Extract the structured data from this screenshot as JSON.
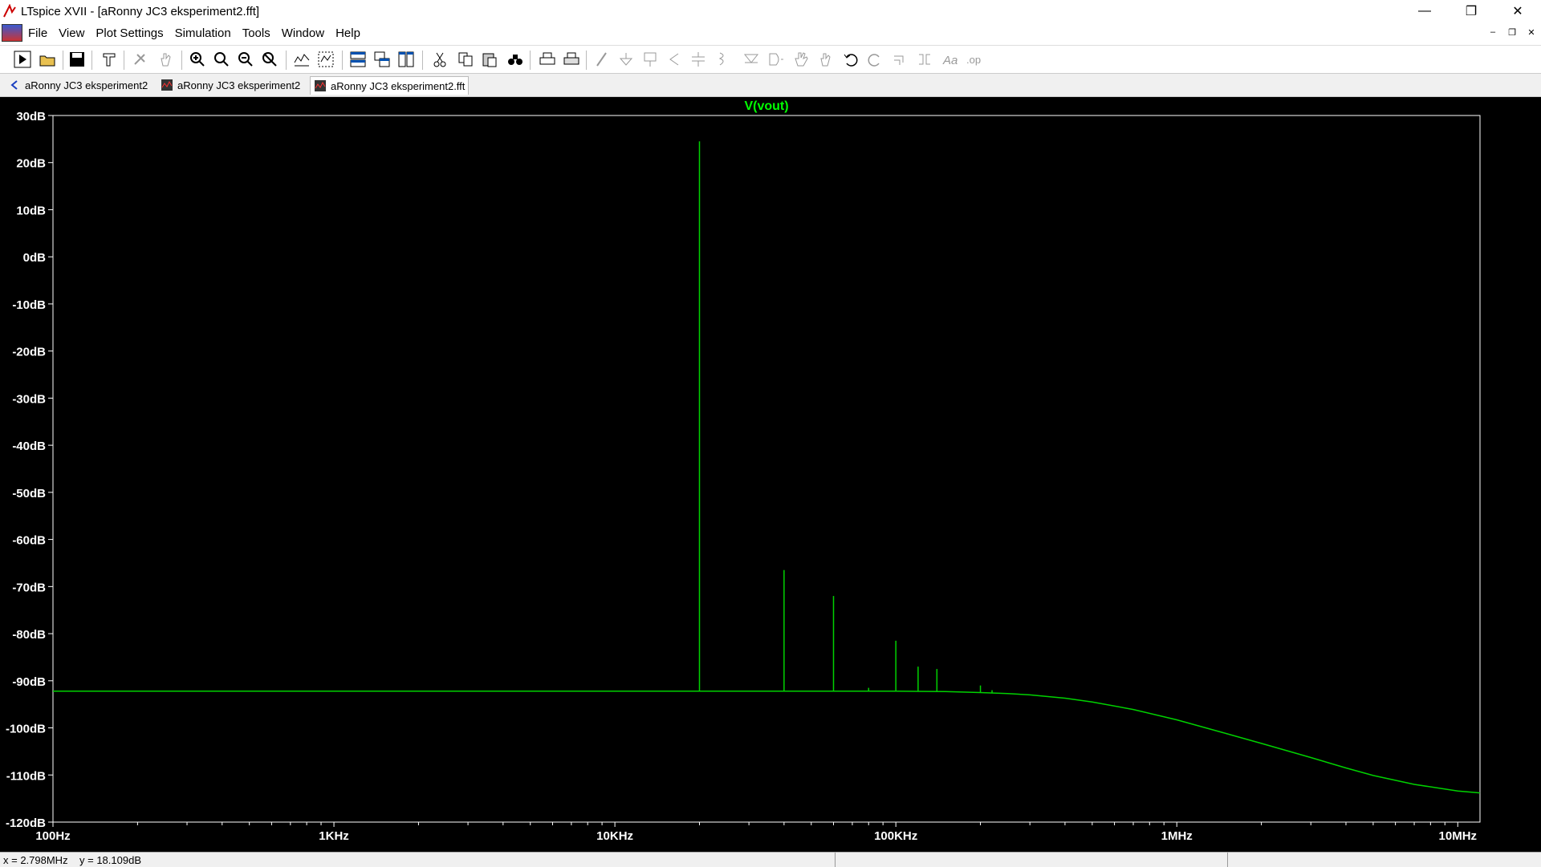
{
  "window": {
    "title": "LTspice XVII - [aRonny JC3 eksperiment2.fft]",
    "controls": [
      "minimize-icon",
      "restore-icon",
      "close-icon"
    ]
  },
  "menu": {
    "items": [
      {
        "label": "File"
      },
      {
        "label": "View"
      },
      {
        "label": "Plot Settings"
      },
      {
        "label": "Simulation"
      },
      {
        "label": "Tools"
      },
      {
        "label": "Window"
      },
      {
        "label": "Help"
      }
    ]
  },
  "toolbar": {
    "icons": [
      "run-icon",
      "open-icon",
      "save-icon",
      "control-panel-icon",
      "pick-icon",
      "pan-icon",
      "zoom-in-icon",
      "zoom-fit-icon",
      "zoom-out-icon",
      "zoom-cancel-icon",
      "autorange-icon",
      "autorange-y-icon",
      "tile-horizontal-icon",
      "cascade-icon",
      "tile-vertical-icon",
      "cut-icon",
      "copy-icon",
      "paste-icon",
      "find-icon",
      "print-icon",
      "print-preview-icon",
      "wire-icon",
      "ground-icon",
      "label-icon",
      "resistor-icon",
      "capacitor-icon",
      "inductor-icon",
      "diode-icon",
      "component-icon",
      "move-icon",
      "drag-icon",
      "undo-icon",
      "redo-icon",
      "rotate-icon",
      "mirror-icon",
      "text-icon",
      "spice-directive-icon"
    ]
  },
  "tabs": [
    {
      "label": "aRonny JC3 eksperiment2",
      "icon": "schematic-icon"
    },
    {
      "label": "aRonny JC3 eksperiment2",
      "icon": "waveform-icon"
    },
    {
      "label": "aRonny JC3 eksperiment2.fft",
      "icon": "waveform-icon",
      "active": true
    }
  ],
  "status": {
    "cursor": "x = 2.798MHz    y = 18.109dB"
  },
  "colors": {
    "trace": "#00d200",
    "plot_bg": "#000000",
    "axis_text": "#ffffff",
    "title_text": "#00ff00"
  },
  "chart_data": {
    "type": "line",
    "title": "V(vout)",
    "xscale": "log",
    "xlim": [
      100,
      12000000
    ],
    "ylim": [
      -120,
      30
    ],
    "grid": false,
    "yticks": [
      "30dB",
      "20dB",
      "10dB",
      "0dB",
      "-10dB",
      "-20dB",
      "-30dB",
      "-40dB",
      "-50dB",
      "-60dB",
      "-70dB",
      "-80dB",
      "-90dB",
      "-100dB",
      "-110dB",
      "-120dB"
    ],
    "ytick_values": [
      30,
      20,
      10,
      0,
      -10,
      -20,
      -30,
      -40,
      -50,
      -60,
      -70,
      -80,
      -90,
      -100,
      -110,
      -120
    ],
    "xticks": [
      "100Hz",
      "1KHz",
      "10KHz",
      "100KHz",
      "1MHz",
      "10MHz"
    ],
    "xtick_values": [
      100,
      1000,
      10000,
      100000,
      1000000,
      10000000
    ],
    "series": [
      {
        "name": "V(vout)",
        "floor": [
          [
            100,
            -92.2
          ],
          [
            100000,
            -92.2
          ],
          [
            150000,
            -92.3
          ],
          [
            200000,
            -92.5
          ],
          [
            250000,
            -92.7
          ],
          [
            300000,
            -93.0
          ],
          [
            400000,
            -93.7
          ],
          [
            500000,
            -94.5
          ],
          [
            700000,
            -96.1
          ],
          [
            1000000,
            -98.3
          ],
          [
            1500000,
            -101.2
          ],
          [
            2000000,
            -103.3
          ],
          [
            3000000,
            -106.3
          ],
          [
            4000000,
            -108.5
          ],
          [
            5000000,
            -110.1
          ],
          [
            7000000,
            -112.0
          ],
          [
            10000000,
            -113.4
          ],
          [
            12000000,
            -113.8
          ]
        ],
        "peaks": [
          {
            "x": 20000,
            "y": 24.5
          },
          {
            "x": 40000,
            "y": -66.5
          },
          {
            "x": 60000,
            "y": -72
          },
          {
            "x": 80000,
            "y": -91.5
          },
          {
            "x": 100000,
            "y": -81.5
          },
          {
            "x": 120000,
            "y": -87
          },
          {
            "x": 140000,
            "y": -87.5
          },
          {
            "x": 200000,
            "y": -91
          },
          {
            "x": 220000,
            "y": -92
          }
        ]
      }
    ]
  }
}
